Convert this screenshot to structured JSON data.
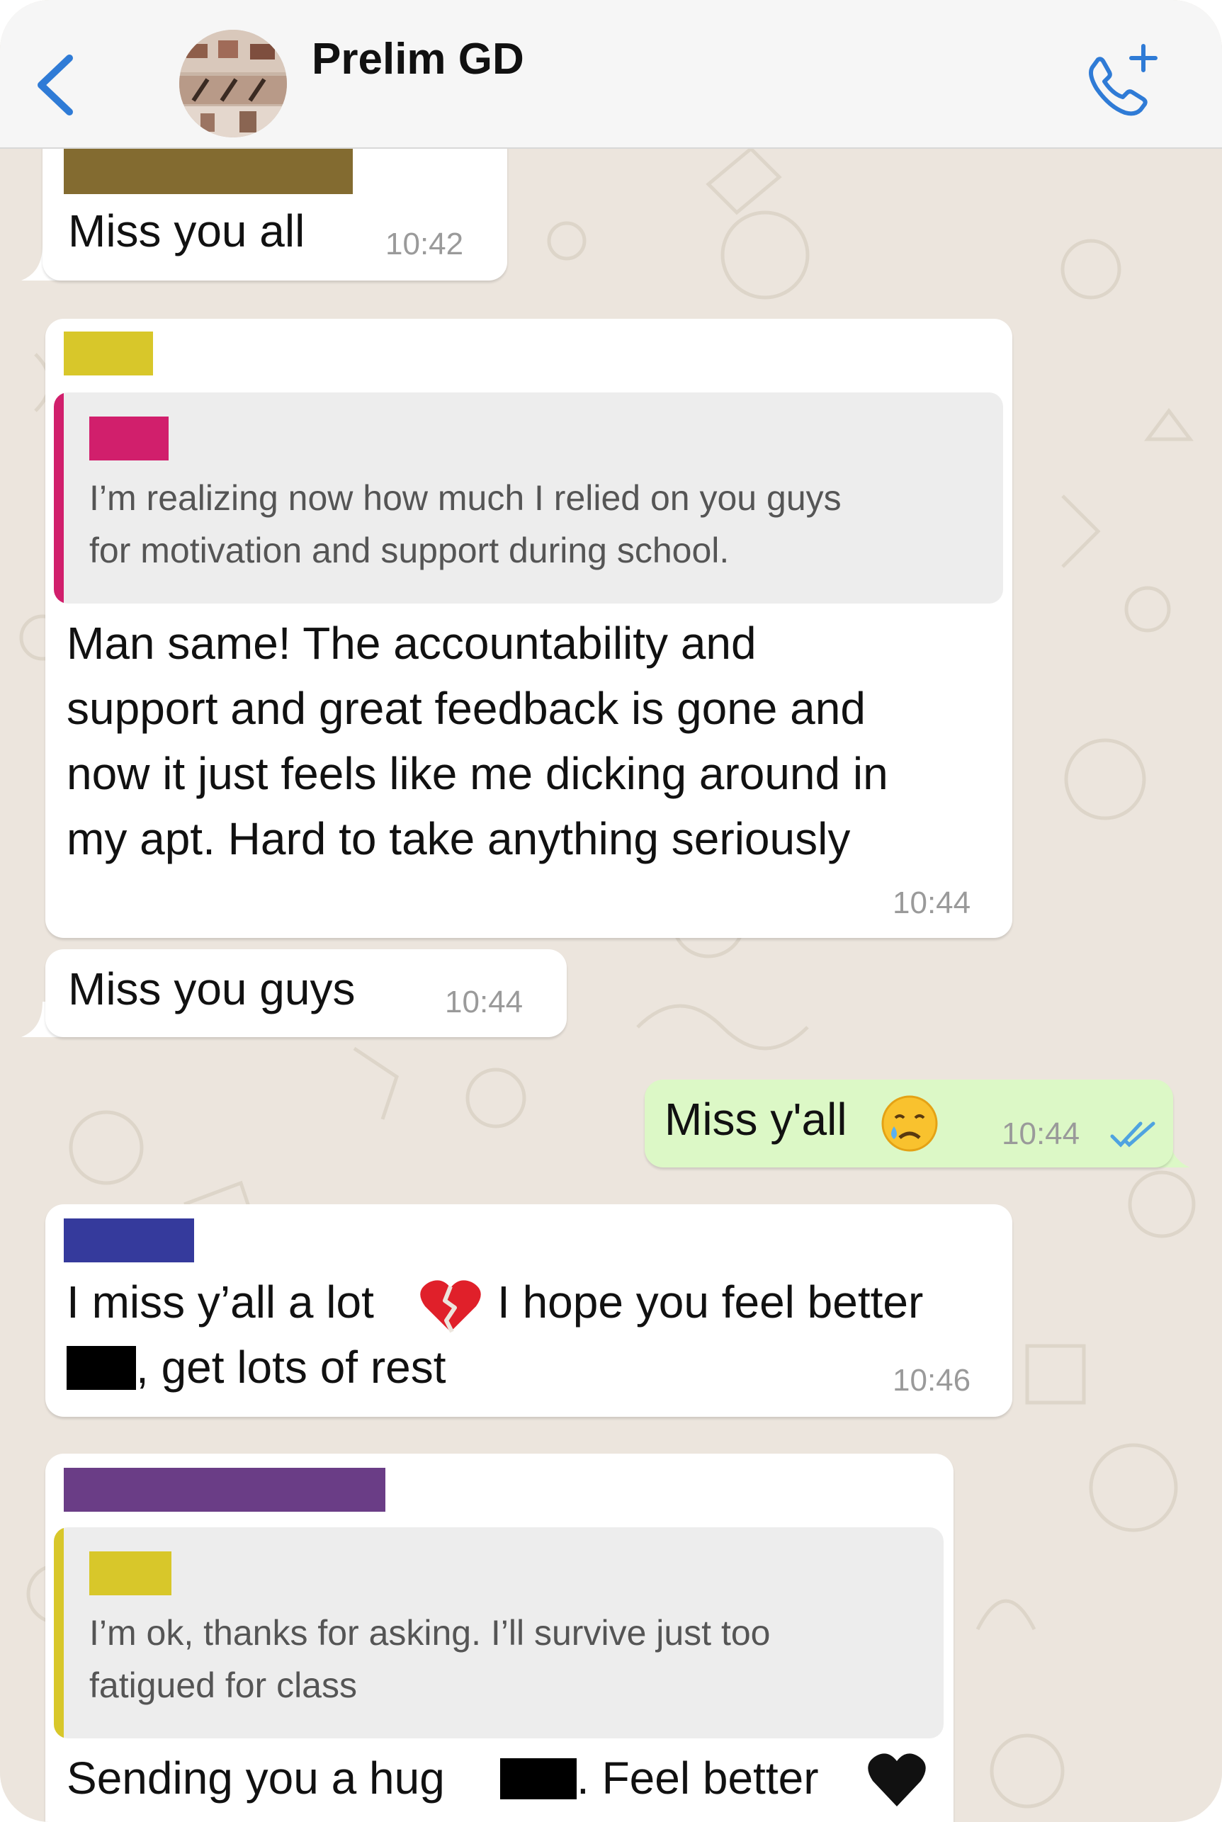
{
  "header": {
    "title": "Prelim GD",
    "back_icon": "chevron-left-icon",
    "call_icon": "phone-add-icon",
    "accent": "#2f7bd6"
  },
  "messages": [
    {
      "text": "Miss you all",
      "time": "10:42",
      "direction": "in",
      "sender_color": "#836b30"
    },
    {
      "direction": "in",
      "sender_color": "#d8c72a",
      "quote": {
        "sender_color": "#d11f6c",
        "text": "I’m realizing now how much I relied on you guys\nfor motivation and support during school."
      },
      "text": "Man same! The accountability and\nsupport and great feedback is gone and\nnow it just feels like me dicking around in\nmy apt. Hard to take anything seriously",
      "time": "10:44"
    },
    {
      "direction": "in",
      "text": "Miss you guys",
      "time": "10:44"
    },
    {
      "direction": "out",
      "text": "Miss y'all",
      "emoji": "crying-face-emoji",
      "time": "10:44",
      "status": "read-double-check-icon",
      "status_color": "#4fa3e0"
    },
    {
      "direction": "in",
      "sender_color": "#353a9c",
      "text_a": "I miss y’all a lot",
      "emoji": "broken-heart-emoji",
      "text_b": "I hope you feel better",
      "text_c": ", get lots of rest",
      "time": "10:46"
    },
    {
      "direction": "in",
      "sender_color": "#6a3d86",
      "quote": {
        "sender_color": "#d8c72a",
        "text": "I’m ok, thanks for asking. I’ll survive just too\nfatigued for class"
      },
      "text_a": "Sending you a hug",
      "text_b": ". Feel better",
      "emoji": "black-heart-emoji"
    }
  ]
}
